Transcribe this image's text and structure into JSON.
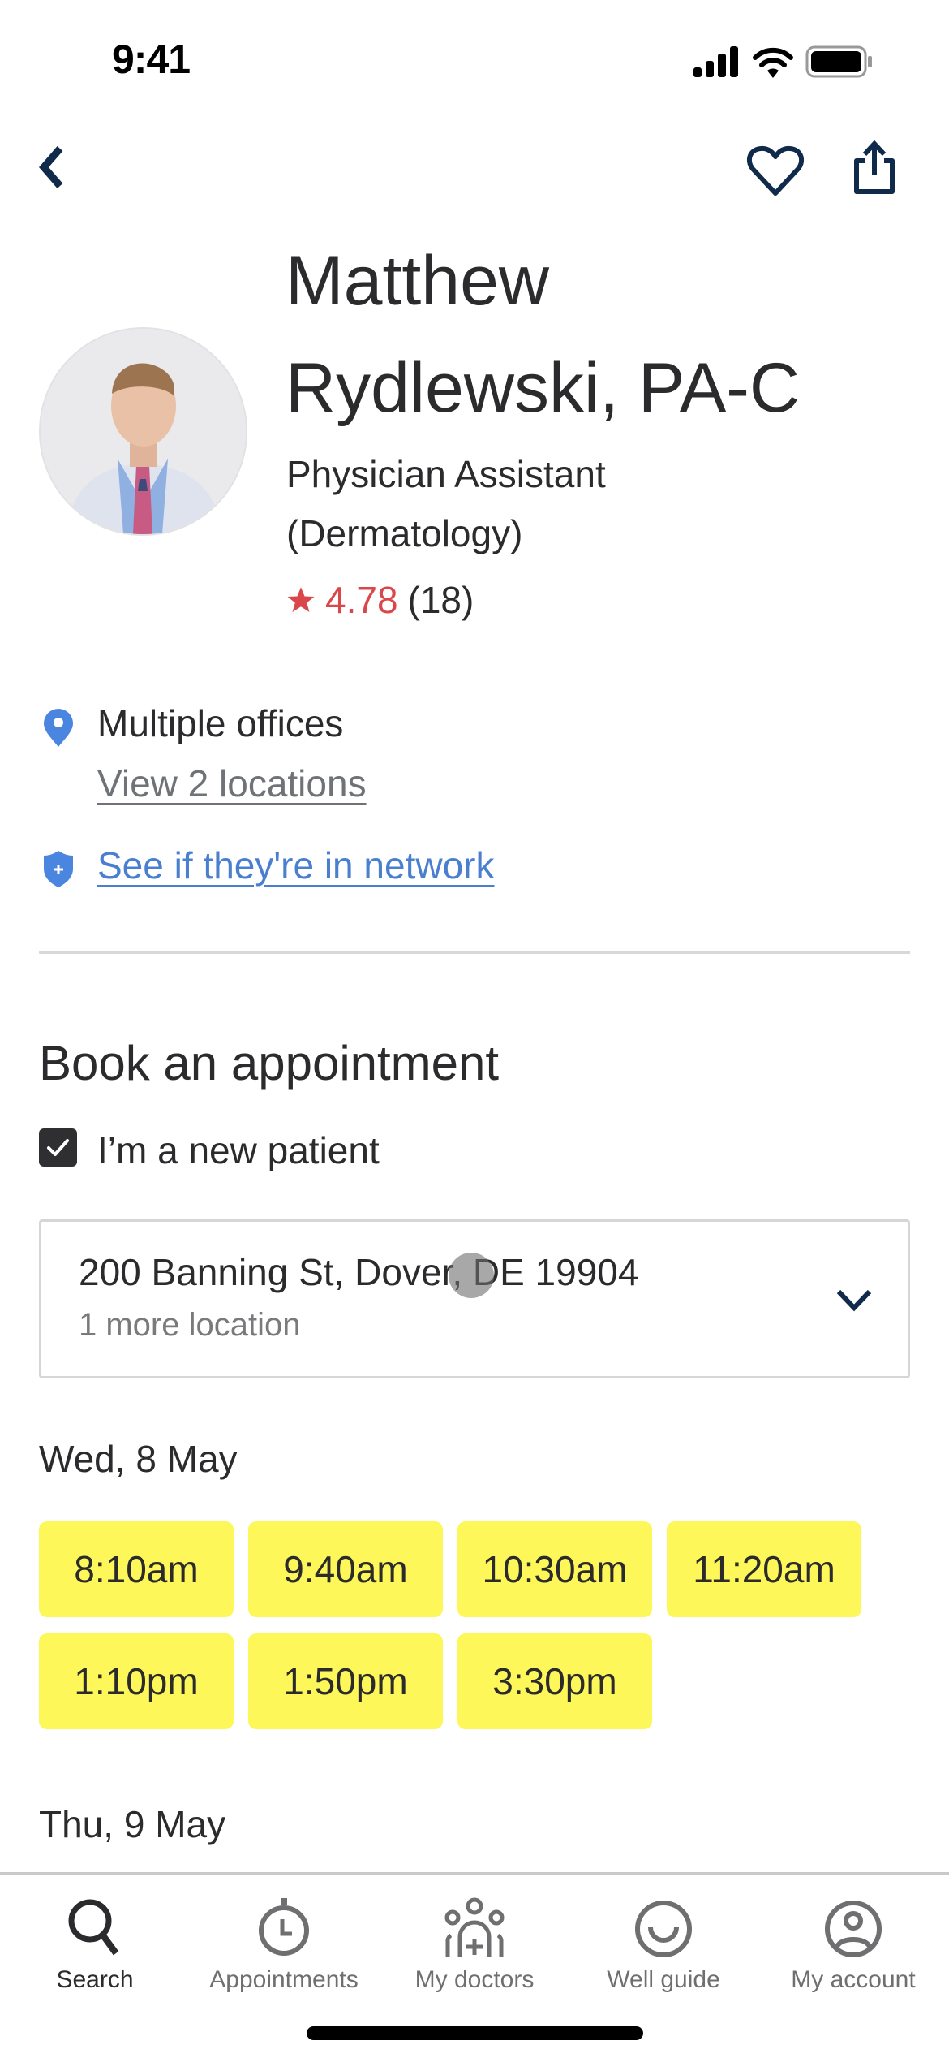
{
  "status_bar": {
    "time": "9:41"
  },
  "nav": {
    "back_icon": "chevron-left-icon",
    "favorite_icon": "heart-icon",
    "share_icon": "share-icon"
  },
  "colors": {
    "navy": "#0f2a4a",
    "rating_red": "#d9474b",
    "link_blue": "#4a7fd0",
    "slot_yellow": "#fdf759",
    "text": "#2b2b2d"
  },
  "provider": {
    "name_line1": "Matthew",
    "name_line2": "Rydlewski, PA-C",
    "specialty_line1": "Physician Assistant",
    "specialty_line2": "(Dermatology)",
    "rating": "4.78",
    "review_count": "(18)"
  },
  "location": {
    "summary": "Multiple offices",
    "view_link": "View 2 locations",
    "network_link": "See if they're in network"
  },
  "booking": {
    "title": "Book an appointment",
    "new_patient_label": "I’m a new patient",
    "new_patient_checked": true,
    "selected_address": "200 Banning St, Dover, DE 19904",
    "more_locations": "1 more location",
    "days": [
      {
        "date": "Wed, 8 May",
        "slots": [
          "8:10am",
          "9:40am",
          "10:30am",
          "11:20am",
          "1:10pm",
          "1:50pm",
          "3:30pm"
        ]
      },
      {
        "date": "Thu, 9 May",
        "slots": []
      }
    ]
  },
  "tabbar": {
    "items": [
      {
        "label": "Search",
        "icon": "search-icon",
        "active": true
      },
      {
        "label": "Appointments",
        "icon": "stopwatch-icon",
        "active": false
      },
      {
        "label": "My doctors",
        "icon": "doctors-group-icon",
        "active": false
      },
      {
        "label": "Well guide",
        "icon": "smile-icon",
        "active": false
      },
      {
        "label": "My account",
        "icon": "account-icon",
        "active": false
      }
    ]
  }
}
